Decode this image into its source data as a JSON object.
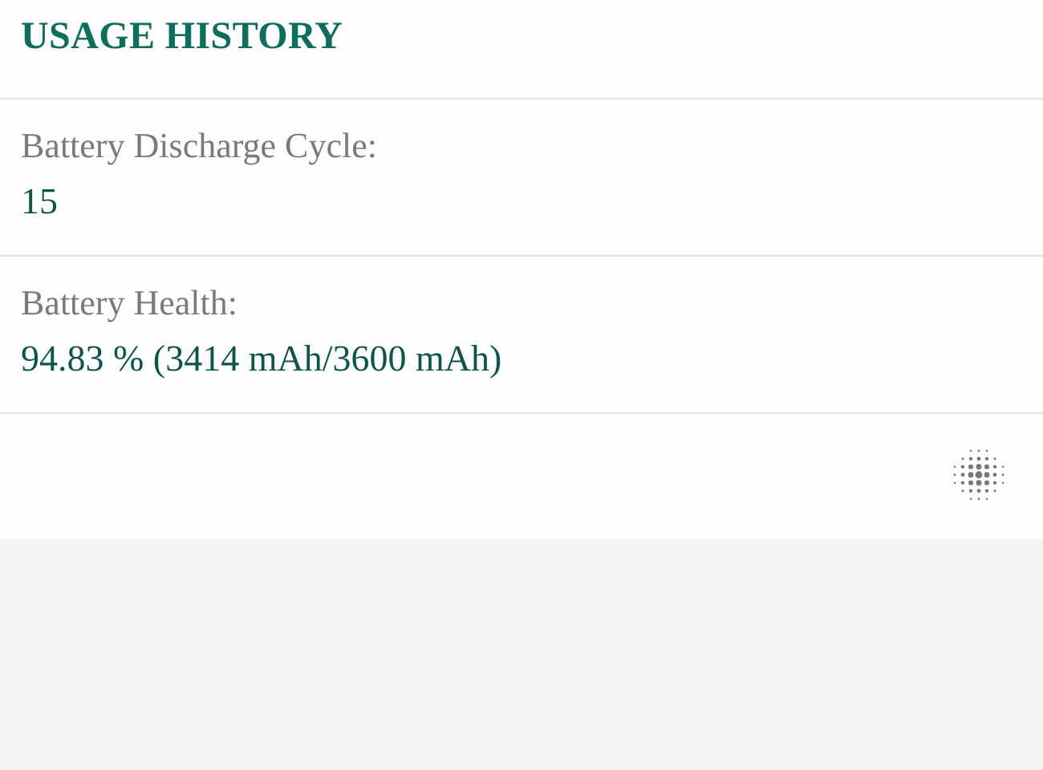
{
  "header": {
    "title": "USAGE HISTORY"
  },
  "items": [
    {
      "label": "Battery Discharge Cycle:",
      "value": "15"
    },
    {
      "label": "Battery Health:",
      "value": "94.83 % (3414 mAh/3600 mAh)"
    }
  ]
}
